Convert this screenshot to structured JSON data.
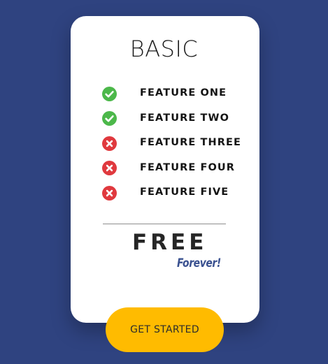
{
  "plan": {
    "title": "BASIC",
    "features": [
      {
        "label": "FEATURE ONE",
        "included": true,
        "icon": "check-circle-icon"
      },
      {
        "label": "FEATURE TWO",
        "included": true,
        "icon": "check-circle-icon"
      },
      {
        "label": "FEATURE THREE",
        "included": false,
        "icon": "x-circle-icon"
      },
      {
        "label": "FEATURE FOUR",
        "included": false,
        "icon": "x-circle-icon"
      },
      {
        "label": "FEATURE FIVE",
        "included": false,
        "icon": "x-circle-icon"
      }
    ],
    "price": "FREE",
    "price_note": "Forever!",
    "cta_label": "GET STARTED"
  },
  "colors": {
    "background": "#2f4380",
    "card": "#ffffff",
    "included": "#4cb84a",
    "excluded": "#e0393e",
    "accent_button": "#ffbb00",
    "price_note": "#3a5190"
  }
}
